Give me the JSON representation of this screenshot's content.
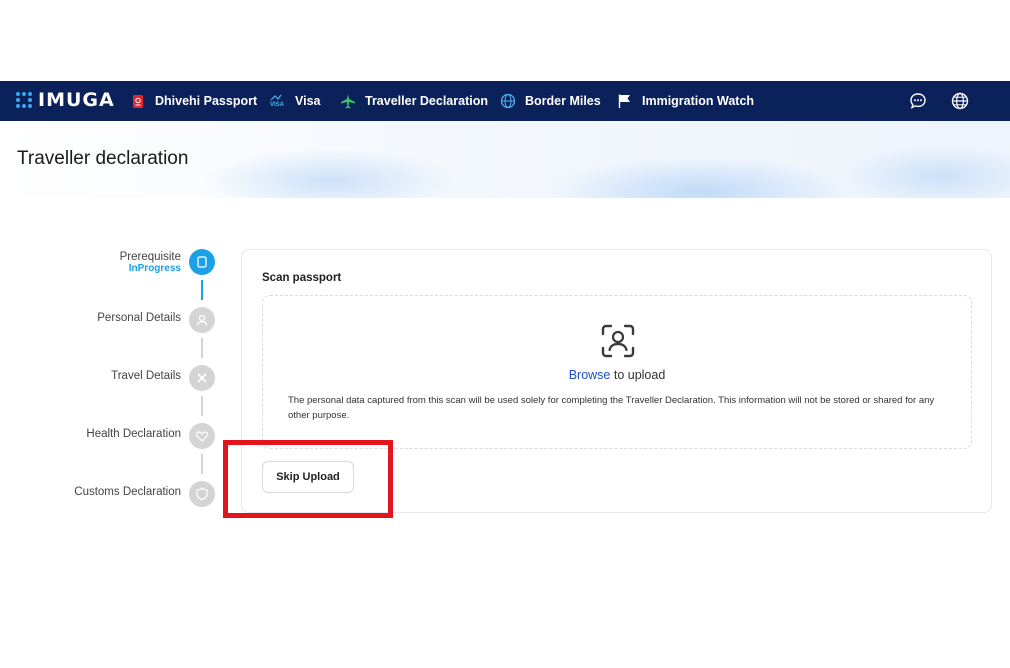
{
  "nav": {
    "logo": "IMUGA",
    "items": [
      {
        "label": "Dhivehi Passport",
        "icon": "passport-icon"
      },
      {
        "label": "Visa",
        "icon": "visa-icon",
        "icon_text": "VISA"
      },
      {
        "label": "Traveller Declaration",
        "icon": "airplane-icon"
      },
      {
        "label": "Border Miles",
        "icon": "globe-network-icon"
      },
      {
        "label": "Immigration Watch",
        "icon": "flag-icon"
      }
    ],
    "right_icons": [
      "chat-icon",
      "language-globe-icon"
    ],
    "colors": {
      "background": "#0b2159",
      "logo_dots": "#3aa8f0"
    }
  },
  "page": {
    "title": "Traveller declaration"
  },
  "stepper": {
    "steps": [
      {
        "label": "Prerequisite",
        "status": "InProgress",
        "icon": "document-icon",
        "active": true
      },
      {
        "label": "Personal Details",
        "status": "",
        "icon": "user-icon",
        "active": false
      },
      {
        "label": "Travel Details",
        "status": "",
        "icon": "airplane-icon",
        "active": false
      },
      {
        "label": "Health Declaration",
        "status": "",
        "icon": "heart-icon",
        "active": false
      },
      {
        "label": "Customs Declaration",
        "status": "",
        "icon": "shield-icon",
        "active": false
      }
    ],
    "colors": {
      "active": "#1da1e6",
      "inactive": "#d4d4d4"
    }
  },
  "scan": {
    "title": "Scan passport",
    "browse_link": "Browse",
    "upload_suffix": " to upload",
    "disclaimer": "The personal data captured from this scan will be used solely for completing the Traveller Declaration. This information will not be stored or shared for any other purpose.",
    "skip_button": "Skip Upload",
    "icon": "face-scan-icon"
  },
  "annotation": {
    "highlight_color": "#e3141c",
    "target": "skip-upload-button"
  }
}
